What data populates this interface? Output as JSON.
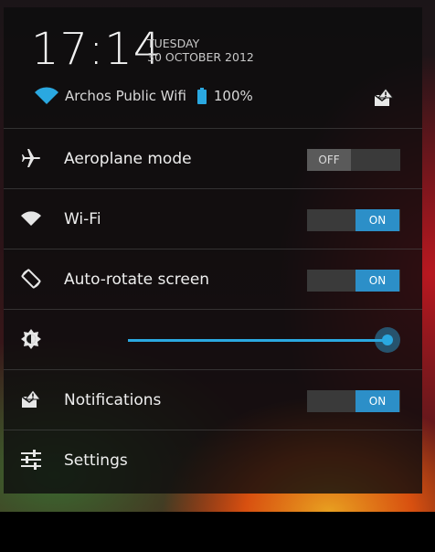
{
  "header": {
    "time": "17:14",
    "day": "TUESDAY",
    "date": "30 OCTOBER 2012",
    "network_name": "Archos Public Wifi",
    "battery_percent": "100%"
  },
  "rows": {
    "aeroplane": {
      "label": "Aeroplane mode",
      "toggle": "OFF"
    },
    "wifi": {
      "label": "Wi-Fi",
      "toggle": "ON"
    },
    "autorotate": {
      "label": "Auto-rotate screen",
      "toggle": "ON"
    },
    "brightness": {
      "level": 1.0
    },
    "notifications": {
      "label": "Notifications",
      "toggle": "ON"
    },
    "settings": {
      "label": "Settings"
    }
  },
  "colors": {
    "accent": "#2aa8e0",
    "toggle_on": "#2c8fc8",
    "panel": "#0c0c0e"
  },
  "icons": {
    "wifi": "wifi-icon",
    "battery": "battery-icon",
    "notifications_header": "notifications-icon",
    "aeroplane": "airplane-icon",
    "autorotate": "rotate-icon",
    "brightness": "brightness-icon",
    "settings": "settings-sliders-icon"
  }
}
